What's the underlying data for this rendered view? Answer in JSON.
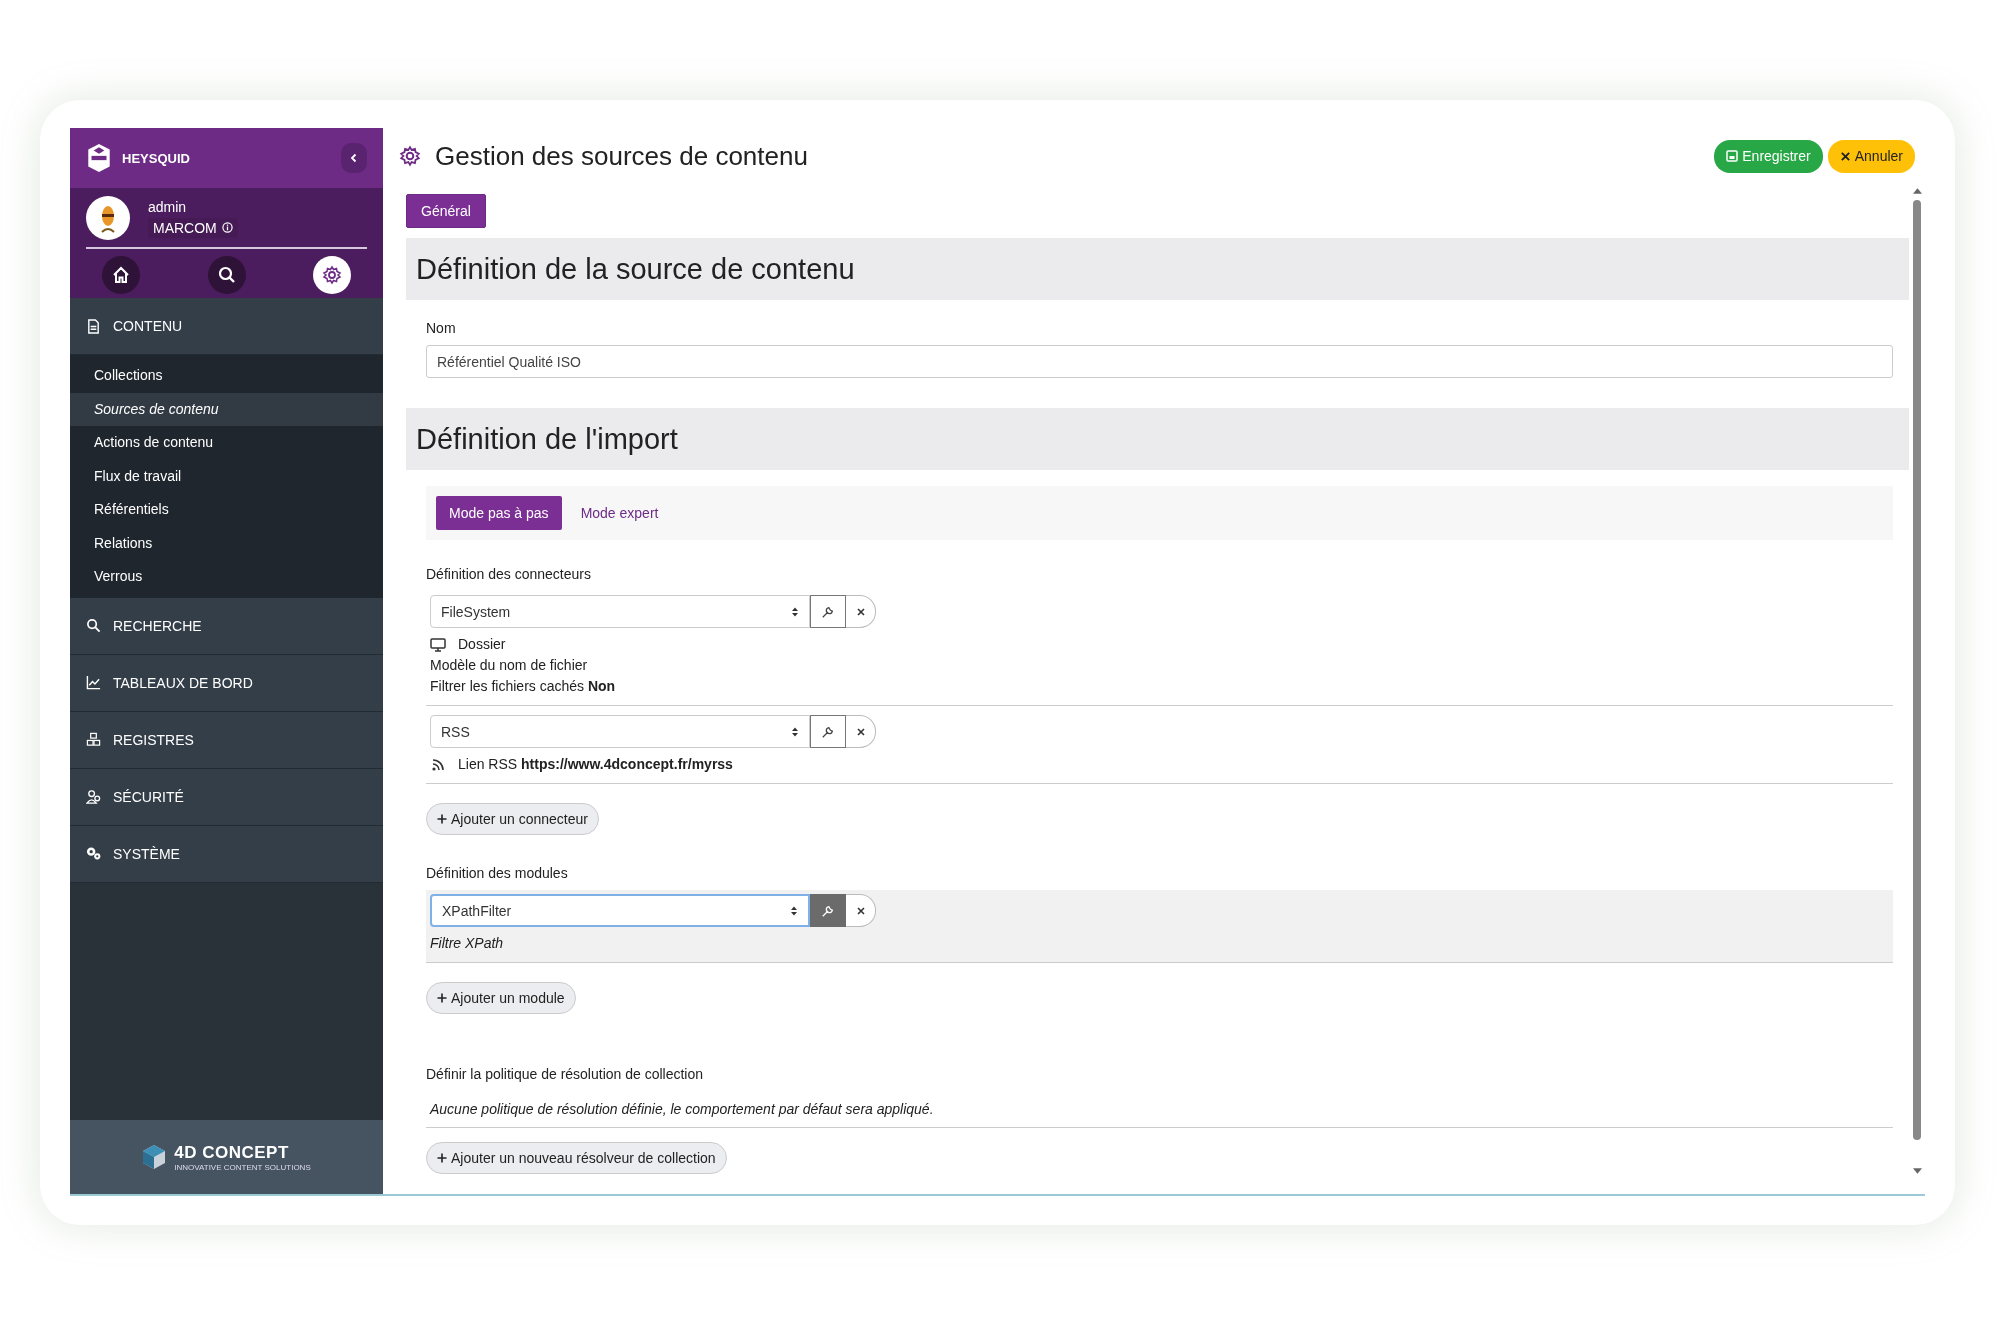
{
  "sidebar": {
    "brand": "HEYSQUID",
    "user": {
      "name": "admin",
      "group": "MARCOM"
    },
    "quick_icons": [
      {
        "kind": "home",
        "selected": false
      },
      {
        "kind": "search",
        "selected": false
      },
      {
        "kind": "settings",
        "selected": true
      }
    ],
    "sections": [
      {
        "label": "CONTENU",
        "kind": "document",
        "expanded": true,
        "children": [
          {
            "label": "Collections",
            "selected": false
          },
          {
            "label": "Sources de contenu",
            "selected": true
          },
          {
            "label": "Actions de contenu",
            "selected": false
          },
          {
            "label": "Flux de travail",
            "selected": false
          },
          {
            "label": "Référentiels",
            "selected": false
          },
          {
            "label": "Relations",
            "selected": false
          },
          {
            "label": "Verrous",
            "selected": false
          }
        ]
      },
      {
        "label": "RECHERCHE",
        "kind": "search",
        "expanded": false
      },
      {
        "label": "TABLEAUX DE BORD",
        "kind": "chart",
        "expanded": false
      },
      {
        "label": "REGISTRES",
        "kind": "cubes",
        "expanded": false
      },
      {
        "label": "SÉCURITÉ",
        "kind": "users",
        "expanded": false
      },
      {
        "label": "SYSTÈME",
        "kind": "gears",
        "expanded": false
      }
    ],
    "footer": {
      "logo": "4D CONCEPT",
      "tagline": "INNOVATIVE CONTENT SOLUTIONS"
    }
  },
  "header": {
    "title": "Gestion des sources de contenu",
    "buttons": [
      {
        "label": "Enregistrer",
        "kind": "save"
      },
      {
        "label": "Annuler",
        "kind": "cancel"
      }
    ]
  },
  "tabs": [
    {
      "label": "Général",
      "selected": true
    }
  ],
  "source_section": {
    "heading": "Définition de la source de contenu",
    "name_field": {
      "label": "Nom",
      "value": "Référentiel Qualité ISO"
    }
  },
  "import_section": {
    "heading": "Définition de l'import",
    "modes": [
      {
        "label": "Mode pas à pas",
        "selected": true
      },
      {
        "label": "Mode expert",
        "selected": false
      }
    ],
    "connectors": {
      "label": "Définition des connecteurs",
      "add_button": "Ajouter un connecteur",
      "items": [
        {
          "value": "FileSystem",
          "focused": false,
          "details": [
            {
              "kind": "folder",
              "text": "Dossier"
            },
            {
              "kind": "plain",
              "text": "Modèle du nom de fichier"
            },
            {
              "kind": "plain",
              "text": "Filtrer les fichiers cachés **Non**"
            }
          ]
        },
        {
          "value": "RSS",
          "focused": false,
          "details": [
            {
              "kind": "rss",
              "text": "Lien RSS **https://www.4dconcept.fr/myrss**"
            }
          ]
        }
      ]
    },
    "modules": {
      "label": "Définition des modules",
      "add_button": "Ajouter un module",
      "items": [
        {
          "value": "XPathFilter",
          "focused": true,
          "details": [
            {
              "kind": "italic",
              "text": "Filtre XPath"
            }
          ]
        }
      ]
    },
    "resolution": {
      "label": "Définir la politique de résolution de collection",
      "note": "Aucune politique de résolution définie, le comportement par défaut sera appliqué.",
      "add_button": "Ajouter un nouveau résolveur de collection"
    }
  }
}
